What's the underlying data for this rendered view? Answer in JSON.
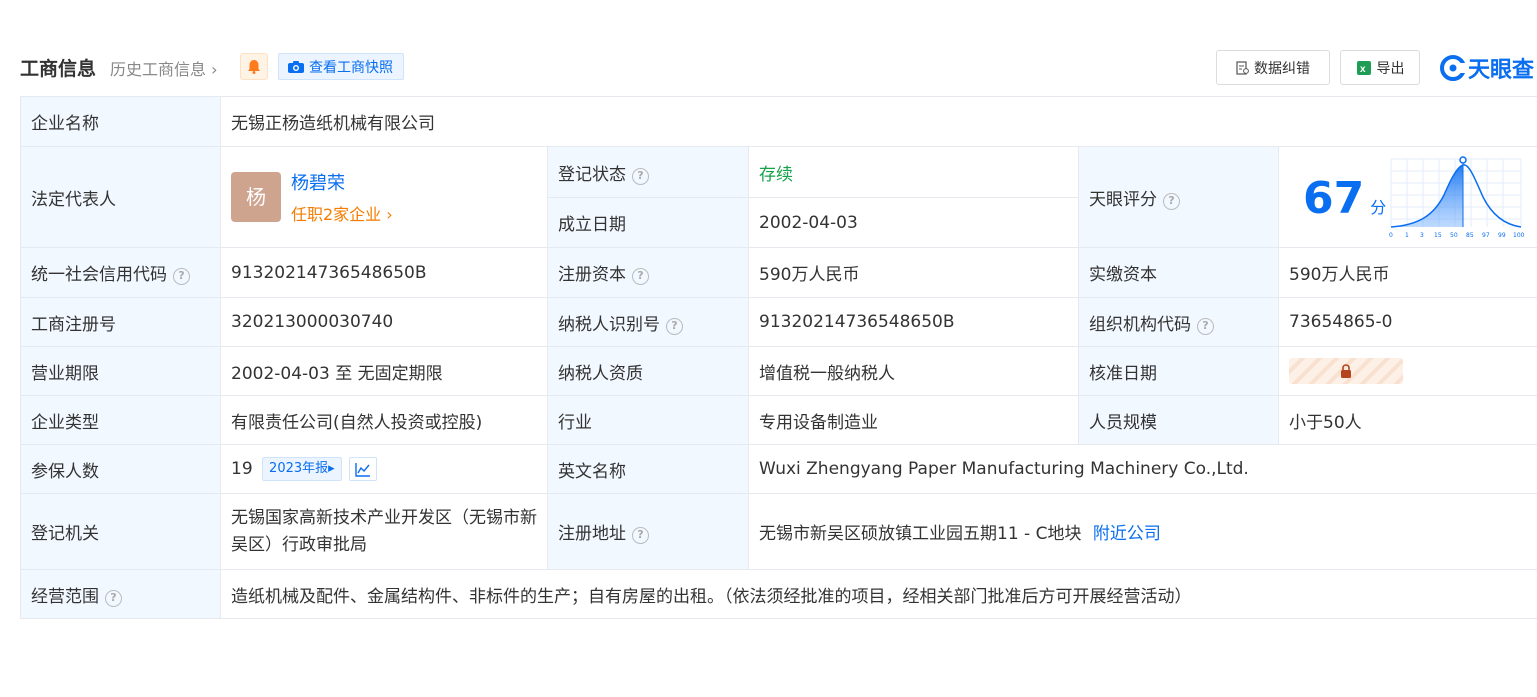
{
  "header": {
    "title": "工商信息",
    "history_label": "历史工商信息",
    "snapshot_label": "查看工商快照",
    "correction_label": "数据纠错",
    "export_label": "导出",
    "brand": "天眼查"
  },
  "company": {
    "name_label": "企业名称",
    "name_value": "无锡正杨造纸机械有限公司",
    "legal_label": "法定代表人",
    "legal_avatar": "杨",
    "legal_name": "杨碧荣",
    "legal_positions": "任职2家企业",
    "status_label": "登记状态",
    "status_value": "存续",
    "founded_label": "成立日期",
    "founded_value": "2002-04-03",
    "score_label": "天眼评分",
    "score_value": "67",
    "score_unit": "分",
    "score_ticks": [
      "0",
      "1",
      "3",
      "15",
      "50",
      "85",
      "97",
      "99",
      "100"
    ],
    "credit_label": "统一社会信用代码",
    "credit_value": "91320214736548650B",
    "reg_capital_label": "注册资本",
    "reg_capital_value": "590万人民币",
    "paid_capital_label": "实缴资本",
    "paid_capital_value": "590万人民币",
    "reg_no_label": "工商注册号",
    "reg_no_value": "320213000030740",
    "taxpayer_id_label": "纳税人识别号",
    "taxpayer_id_value": "91320214736548650B",
    "org_code_label": "组织机构代码",
    "org_code_value": "73654865-0",
    "term_label": "营业期限",
    "term_value": "2002-04-03 至 无固定期限",
    "taxpayer_qual_label": "纳税人资质",
    "taxpayer_qual_value": "增值税一般纳税人",
    "approval_label": "核准日期",
    "type_label": "企业类型",
    "type_value": "有限责任公司(自然人投资或控股)",
    "industry_label": "行业",
    "industry_value": "专用设备制造业",
    "staff_label": "人员规模",
    "staff_value": "小于50人",
    "insured_label": "参保人数",
    "insured_value": "19",
    "insured_report": "2023年报",
    "en_name_label": "英文名称",
    "en_name_value": "Wuxi Zhengyang Paper Manufacturing Machinery Co.,Ltd.",
    "authority_label": "登记机关",
    "authority_value": "无锡国家高新技术产业开发区（无锡市新吴区）行政审批局",
    "address_label": "注册地址",
    "address_value": "无锡市新吴区硕放镇工业园五期11 - C地块",
    "nearby_label": "附近公司",
    "scope_label": "经营范围",
    "scope_value": "造纸机械及配件、金属结构件、非标件的生产；自有房屋的出租。（依法须经批准的项目，经相关部门批准后方可开展经营活动）"
  },
  "colors": {
    "accent": "#0a6ef0",
    "label_bg": "#f2f8ff",
    "status": "#16a34a",
    "orange": "#f57c00"
  }
}
